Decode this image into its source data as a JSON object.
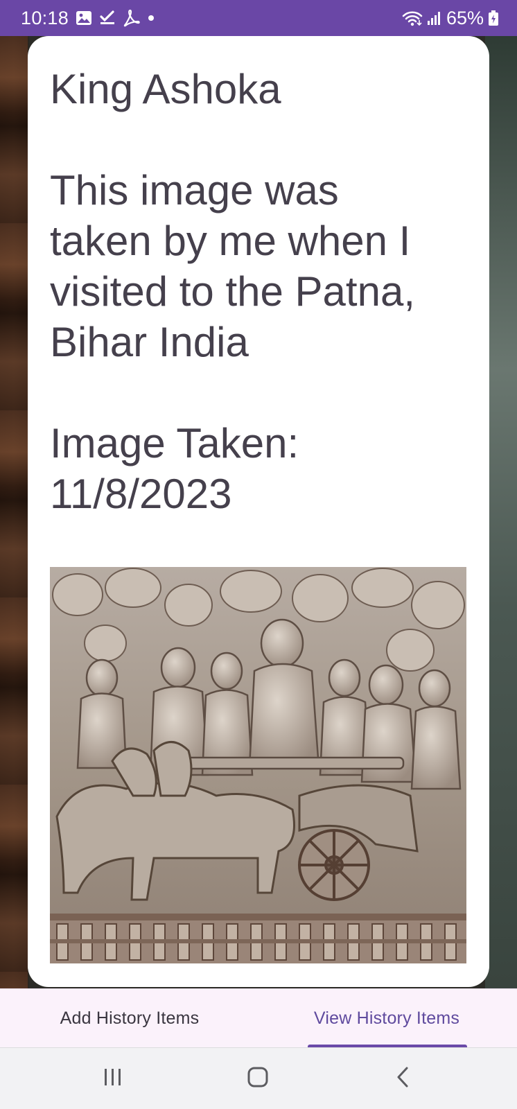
{
  "status_bar": {
    "time": "10:18",
    "battery": "65%",
    "background": "#6a47a6",
    "icons": [
      "gallery-icon",
      "task-check-icon",
      "pdf-icon",
      "notification-dot-icon",
      "wifi-icon",
      "signal-icon",
      "battery-icon"
    ]
  },
  "card": {
    "title": "King Ashoka",
    "description_lines": [
      "This image was",
      "taken by me when I",
      "visited to the Patna,",
      "Bihar India"
    ],
    "date_label": "Image Taken:",
    "date_value": "11/8/2023"
  },
  "tabs": {
    "add_label": "Add History Items",
    "view_label": "View History Items",
    "selected": "View History Items",
    "accent": "#6a4aa8"
  },
  "nav_bar": {
    "icons": [
      "recent-apps-icon",
      "home-icon",
      "back-icon"
    ]
  }
}
